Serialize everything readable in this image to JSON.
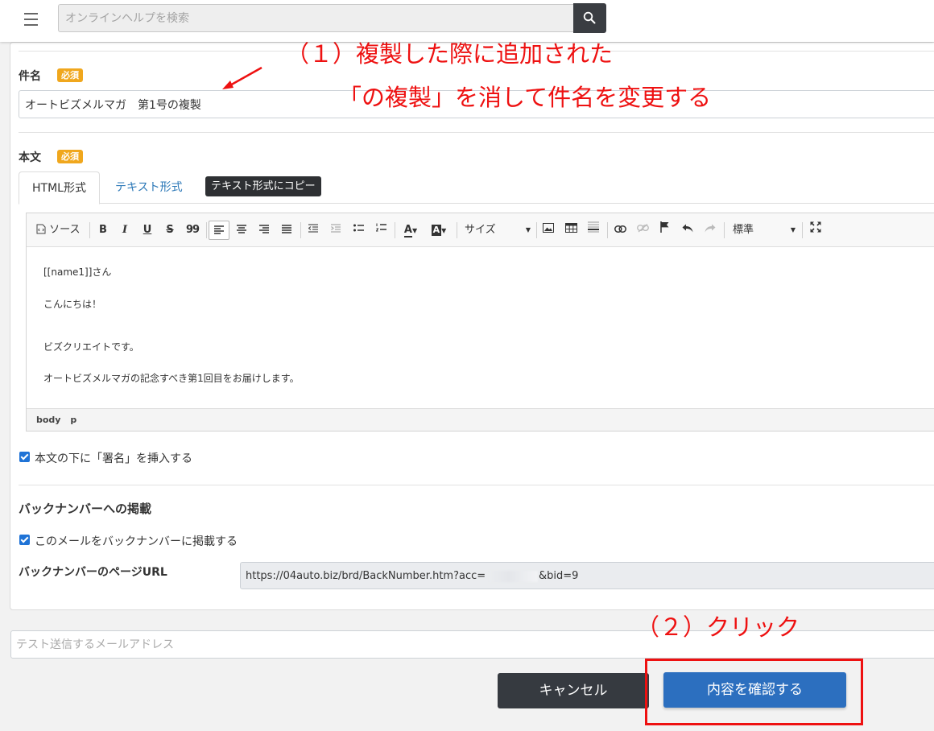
{
  "header": {
    "search_placeholder": "オンラインヘルプを検索"
  },
  "subject": {
    "label": "件名",
    "required_badge": "必須",
    "value": "オートビズメルマガ　第1号の複製"
  },
  "body_field": {
    "label": "本文",
    "required_badge": "必須",
    "tabs": [
      {
        "label": "HTML形式",
        "active": true
      },
      {
        "label": "テキスト形式",
        "active": false
      }
    ],
    "tooltip": "テキスト形式にコピー",
    "toolbar": {
      "source_label": "ソース",
      "bold": "B",
      "italic": "I",
      "underline": "U",
      "strike": "S",
      "quote": "99",
      "size_label": "サイズ",
      "format_label": "標準"
    },
    "content": [
      "[[name1]]さん",
      "こんにちは！",
      "ビズクリエイトです。",
      "オートビズメルマガの記念すべき第1回目をお届けします。"
    ],
    "status_path": [
      "body",
      "p"
    ]
  },
  "signature_checkbox": {
    "label": "本文の下に「署名」を挿入する",
    "checked": true
  },
  "backnumber": {
    "heading": "バックナンバーへの掲載",
    "checkbox_label": "このメールをバックナンバーに掲載する",
    "checked": true,
    "url_label": "バックナンバーのページURL",
    "url_prefix": "https://04auto.biz/brd/BackNumber.htm?acc=",
    "url_suffix": "&bid=9"
  },
  "test_email": {
    "placeholder": "テスト送信するメールアドレス"
  },
  "buttons": {
    "cancel": "キャンセル",
    "confirm": "内容を確認する"
  },
  "annotations": {
    "step1_line1": "（１）複製した際に追加された",
    "step1_line2": "「の複製」を消して件名を変更する",
    "step2": "（２）クリック",
    "color": "#ee1111"
  },
  "colors": {
    "primary": "#2c6fbf",
    "dark_button": "#363a40",
    "required_badge": "#f0a71d",
    "link": "#2d79b8"
  }
}
